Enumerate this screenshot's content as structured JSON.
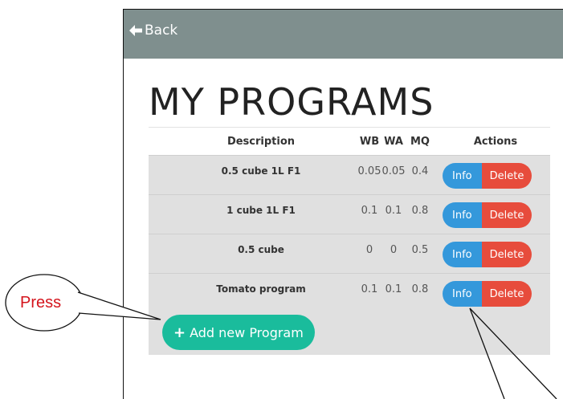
{
  "topbar": {
    "back_label": "Back"
  },
  "page": {
    "title": "MY PROGRAMS"
  },
  "table": {
    "headers": {
      "description": "Description",
      "wb": "WB",
      "wa": "WA",
      "mq": "MQ",
      "actions": "Actions"
    },
    "rows": [
      {
        "description": "0.5 cube 1L F1",
        "wb": "0.05",
        "wa": "0.05",
        "mq": "0.4",
        "info": "Info",
        "delete": "Delete"
      },
      {
        "description": "1 cube 1L F1",
        "wb": "0.1",
        "wa": "0.1",
        "mq": "0.8",
        "info": "Info",
        "delete": "Delete"
      },
      {
        "description": "0.5 cube",
        "wb": "0",
        "wa": "0",
        "mq": "0.5",
        "info": "Info",
        "delete": "Delete"
      },
      {
        "description": "Tomato program",
        "wb": "0.1",
        "wa": "0.1",
        "mq": "0.8",
        "info": "Info",
        "delete": "Delete"
      }
    ]
  },
  "add_button": {
    "label": "Add new Program",
    "icon": "plus-icon"
  },
  "annotation": {
    "callout_text": "Press"
  },
  "colors": {
    "topbar": "#7f8f8e",
    "info": "#3498db",
    "delete": "#e74c3c",
    "add": "#1abc9c",
    "callout_text": "#d4141c"
  }
}
